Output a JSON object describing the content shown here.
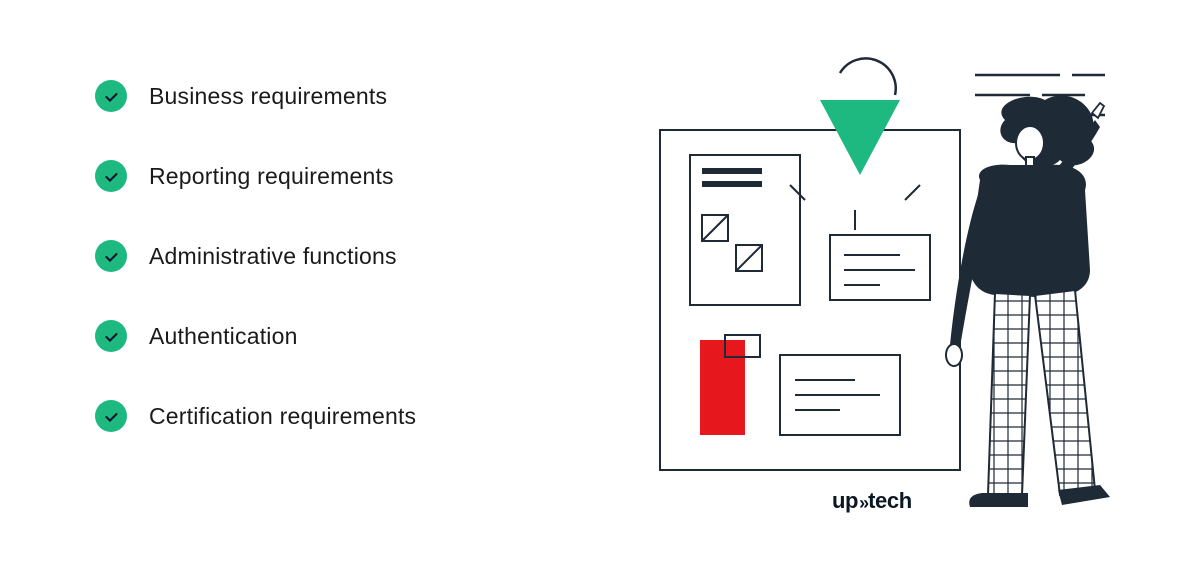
{
  "list": {
    "items": [
      {
        "label": "Business requirements"
      },
      {
        "label": "Reporting requirements"
      },
      {
        "label": "Administrative functions"
      },
      {
        "label": "Authentication"
      },
      {
        "label": "Certification requirements"
      }
    ]
  },
  "logo": {
    "part1": "up",
    "sep": "»",
    "part2": "tech"
  },
  "colors": {
    "accent_green": "#1eb980",
    "accent_red": "#e6181e",
    "dark": "#1f2a37"
  }
}
